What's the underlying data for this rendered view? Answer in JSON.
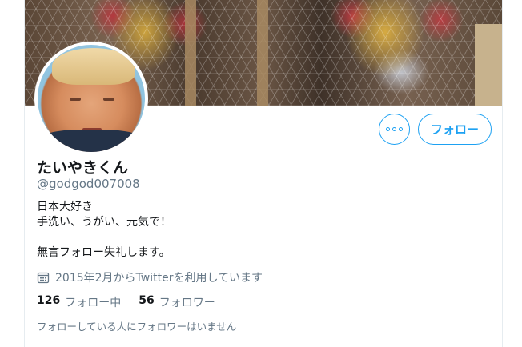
{
  "profile": {
    "name": "たいやきくん",
    "handle": "@godgod007008",
    "bio": [
      "日本大好き",
      "手洗い、うがい、元気で！",
      "",
      "無言フォロー失礼します。"
    ],
    "joined": "2015年2月からTwitterを利用しています"
  },
  "actions": {
    "more_icon": "more-horizontal-icon",
    "follow_label": "フォロー"
  },
  "stats": {
    "following_count": "126",
    "following_label": "フォロー中",
    "followers_count": "56",
    "followers_label": "フォロワー"
  },
  "followers_note": "フォローしている人にフォロワーはいません",
  "colors": {
    "accent": "#1da1f2",
    "secondary_text": "#657786",
    "primary_text": "#14171a"
  },
  "icons": {
    "calendar": "calendar-icon"
  }
}
